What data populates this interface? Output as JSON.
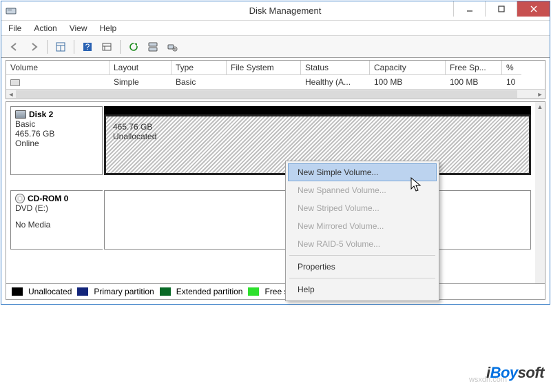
{
  "window": {
    "title": "Disk Management"
  },
  "menu": {
    "file": "File",
    "action": "Action",
    "view": "View",
    "help": "Help"
  },
  "columns": {
    "volume": "Volume",
    "layout": "Layout",
    "type": "Type",
    "fs": "File System",
    "status": "Status",
    "capacity": "Capacity",
    "free": "Free Sp...",
    "pct": "%"
  },
  "row": {
    "volume": "",
    "layout": "Simple",
    "type": "Basic",
    "fs": "",
    "status": "Healthy (A...",
    "capacity": "100 MB",
    "free": "100 MB",
    "pct": "10"
  },
  "disk2": {
    "title": "Disk 2",
    "kind": "Basic",
    "size": "465.76 GB",
    "state": "Online",
    "part_size": "465.76 GB",
    "part_status": "Unallocated"
  },
  "cdrom": {
    "title": "CD-ROM 0",
    "drive": "DVD (E:)",
    "state": "No Media"
  },
  "legend": {
    "unallocated": "Unallocated",
    "primary": "Primary partition",
    "extended": "Extended partition",
    "free": "Free space"
  },
  "context": {
    "new_simple": "New Simple Volume...",
    "new_spanned": "New Spanned Volume...",
    "new_striped": "New Striped Volume...",
    "new_mirrored": "New Mirrored Volume...",
    "new_raid5": "New RAID-5 Volume...",
    "properties": "Properties",
    "help": "Help"
  },
  "brand": {
    "i": "i",
    "boy": "Boy",
    "soft": "soft",
    "domain": "wsxdn.com"
  }
}
